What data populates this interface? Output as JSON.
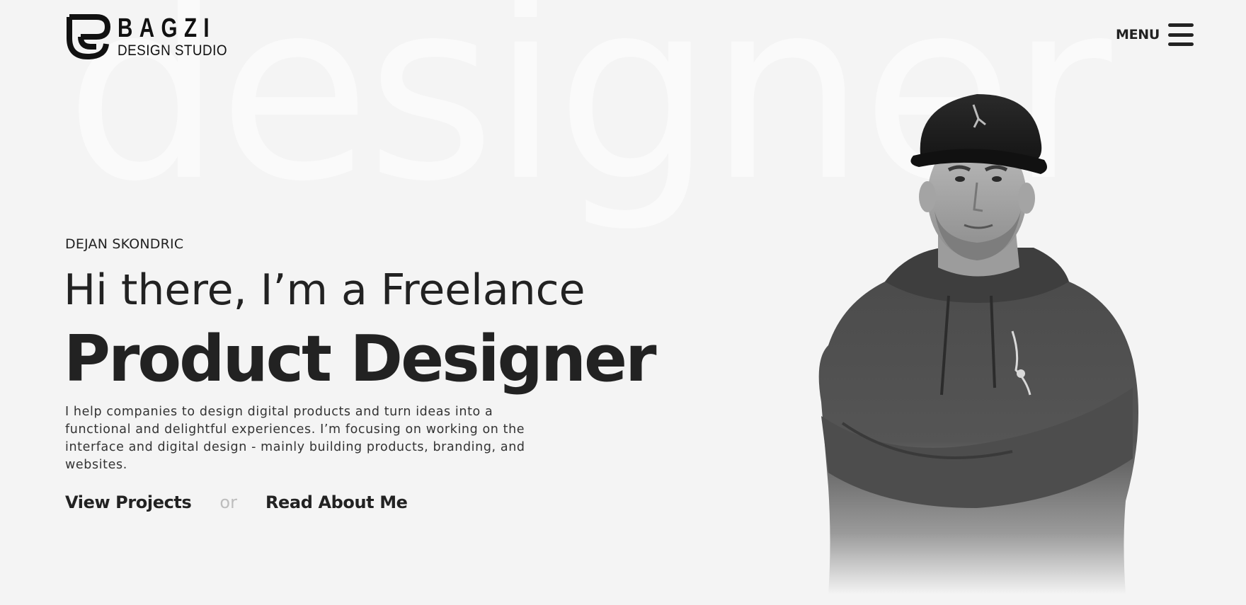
{
  "header": {
    "logo": {
      "name": "BAGZI",
      "subtitle": "DESIGN STUDIO"
    },
    "menu_label": "MENU"
  },
  "background_word": "designer",
  "hero": {
    "eyebrow": "DEJAN SKONDRIC",
    "title_line1": "Hi there, I’m a Freelance",
    "title_line2": "Product Designer",
    "description": "I help companies to design digital products and turn ideas into a functional and delightful experiences. I’m focusing on working on the interface and digital design - mainly building products, branding, and websites.",
    "cta_primary": "View Projects",
    "cta_separator": "or",
    "cta_secondary": "Read About Me"
  },
  "colors": {
    "background": "#f4f4f4",
    "text": "#222222",
    "muted": "#bdbdbd"
  },
  "icons": {
    "menu": "hamburger-icon",
    "logo": "bagzi-logo-mark"
  }
}
